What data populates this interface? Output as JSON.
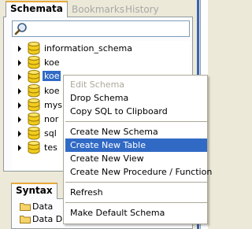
{
  "top_tabs": [
    {
      "label": "Schemata",
      "active": true
    },
    {
      "label": "Bookmarks",
      "active": false
    },
    {
      "label": "History",
      "active": false
    }
  ],
  "search": {
    "value": "",
    "placeholder": ""
  },
  "schemas": [
    {
      "label": "information_schema",
      "selected": false
    },
    {
      "label": "koe",
      "selected": false
    },
    {
      "label": "koe",
      "selected": true
    },
    {
      "label": "koe",
      "selected": false
    },
    {
      "label": "mys",
      "selected": false
    },
    {
      "label": "nor",
      "selected": false
    },
    {
      "label": "sql",
      "selected": false
    },
    {
      "label": "tes",
      "selected": false
    }
  ],
  "bottom_tabs": [
    {
      "label": "Syntax",
      "active": true
    }
  ],
  "syntax_items": [
    {
      "label": "Data"
    },
    {
      "label": "Data Definition"
    }
  ],
  "context_menu": {
    "items": [
      {
        "label": "Edit Schema",
        "enabled": false
      },
      {
        "label": "Drop Schema",
        "enabled": true
      },
      {
        "label": "Copy SQL to Clipboard",
        "enabled": true
      },
      {
        "label": "Create New Schema",
        "enabled": true
      },
      {
        "label": "Create New Table",
        "enabled": true,
        "highlighted": true
      },
      {
        "label": "Create New View",
        "enabled": true
      },
      {
        "label": "Create New Procedure / Function",
        "enabled": true
      },
      {
        "label": "Refresh",
        "enabled": true
      },
      {
        "label": "Make Default Schema",
        "enabled": true
      }
    ]
  },
  "colors": {
    "selection": "#316ac5",
    "tab_accent": "#e8a93a",
    "panel_background": "#ece9d8",
    "database_icon": "#e8c000"
  }
}
